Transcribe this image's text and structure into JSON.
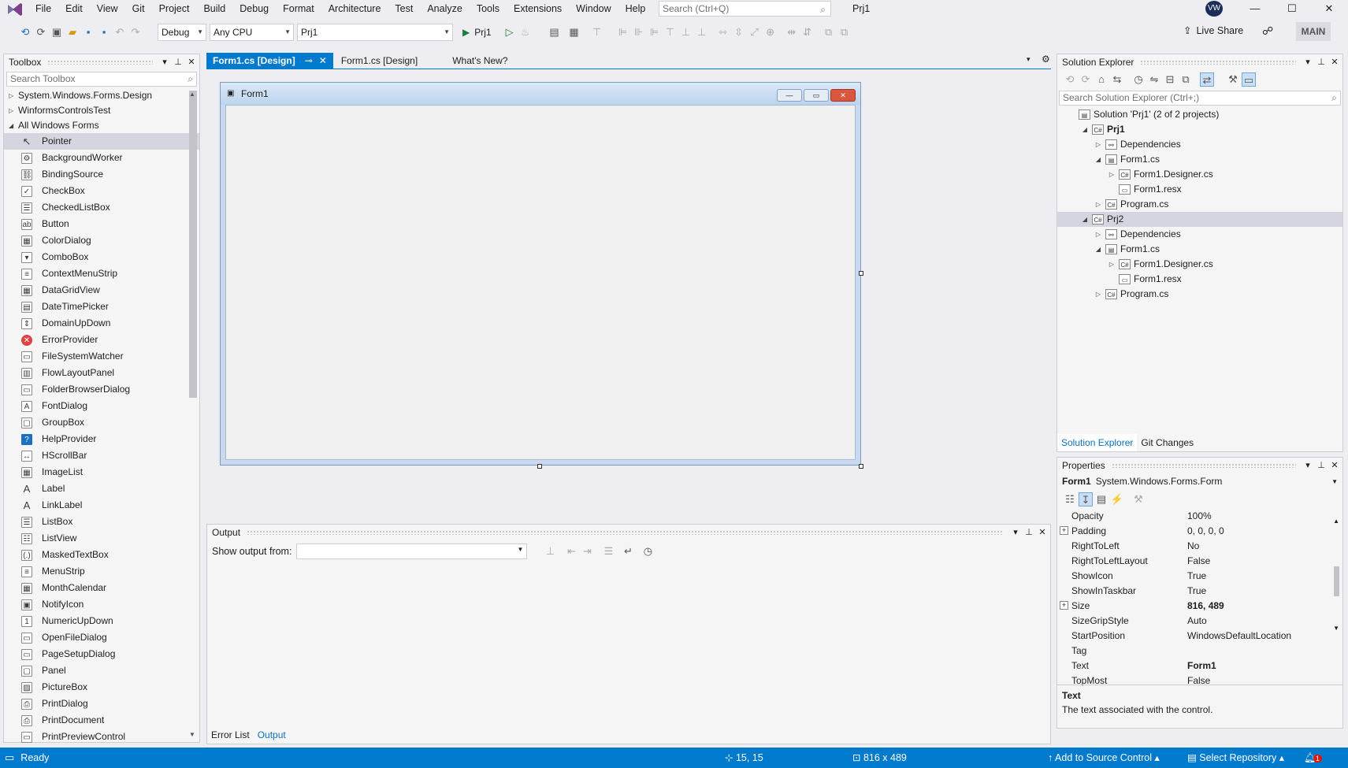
{
  "menu": {
    "items": [
      "File",
      "Edit",
      "View",
      "Git",
      "Project",
      "Build",
      "Debug",
      "Format",
      "Architecture",
      "Test",
      "Analyze",
      "Tools",
      "Extensions",
      "Window",
      "Help"
    ],
    "search_placeholder": "Search (Ctrl+Q)",
    "solution_title": "Prj1",
    "avatar_initials": "VW"
  },
  "toolbar": {
    "config": "Debug",
    "platform": "Any CPU",
    "startup_project": "Prj1",
    "run_label": "Prj1",
    "live_share": "Live Share",
    "main_badge": "MAIN"
  },
  "toolbox": {
    "title": "Toolbox",
    "search_placeholder": "Search Toolbox",
    "groups": [
      "System.Windows.Forms.Design",
      "WinformsControlsTest",
      "All Windows Forms"
    ],
    "items": [
      {
        "label": "Pointer",
        "icon": "pointer-icon",
        "glyph": "↖"
      },
      {
        "label": "BackgroundWorker",
        "icon": "background-worker-icon",
        "glyph": "⚙"
      },
      {
        "label": "BindingSource",
        "icon": "binding-source-icon",
        "glyph": "⛓"
      },
      {
        "label": "CheckBox",
        "icon": "checkbox-icon",
        "glyph": "✓"
      },
      {
        "label": "CheckedListBox",
        "icon": "checked-list-icon",
        "glyph": "☰"
      },
      {
        "label": "Button",
        "icon": "button-icon",
        "glyph": "ab"
      },
      {
        "label": "ColorDialog",
        "icon": "color-dialog-icon",
        "glyph": "▦"
      },
      {
        "label": "ComboBox",
        "icon": "combobox-icon",
        "glyph": "▾"
      },
      {
        "label": "ContextMenuStrip",
        "icon": "context-menu-icon",
        "glyph": "≡"
      },
      {
        "label": "DataGridView",
        "icon": "datagrid-icon",
        "glyph": "▦"
      },
      {
        "label": "DateTimePicker",
        "icon": "datetime-icon",
        "glyph": "▤"
      },
      {
        "label": "DomainUpDown",
        "icon": "domain-updown-icon",
        "glyph": "⇕"
      },
      {
        "label": "ErrorProvider",
        "icon": "error-provider-icon",
        "glyph": "✕"
      },
      {
        "label": "FileSystemWatcher",
        "icon": "file-watcher-icon",
        "glyph": "▭"
      },
      {
        "label": "FlowLayoutPanel",
        "icon": "flow-layout-icon",
        "glyph": "▥"
      },
      {
        "label": "FolderBrowserDialog",
        "icon": "folder-browser-icon",
        "glyph": "▭"
      },
      {
        "label": "FontDialog",
        "icon": "font-dialog-icon",
        "glyph": "A"
      },
      {
        "label": "GroupBox",
        "icon": "groupbox-icon",
        "glyph": "▢"
      },
      {
        "label": "HelpProvider",
        "icon": "help-provider-icon",
        "glyph": "?"
      },
      {
        "label": "HScrollBar",
        "icon": "hscrollbar-icon",
        "glyph": "↔"
      },
      {
        "label": "ImageList",
        "icon": "imagelist-icon",
        "glyph": "▦"
      },
      {
        "label": "Label",
        "icon": "label-icon",
        "glyph": "A"
      },
      {
        "label": "LinkLabel",
        "icon": "linklabel-icon",
        "glyph": "A"
      },
      {
        "label": "ListBox",
        "icon": "listbox-icon",
        "glyph": "☰"
      },
      {
        "label": "ListView",
        "icon": "listview-icon",
        "glyph": "☷"
      },
      {
        "label": "MaskedTextBox",
        "icon": "masked-textbox-icon",
        "glyph": "(.)"
      },
      {
        "label": "MenuStrip",
        "icon": "menustrip-icon",
        "glyph": "≡"
      },
      {
        "label": "MonthCalendar",
        "icon": "month-calendar-icon",
        "glyph": "▦"
      },
      {
        "label": "NotifyIcon",
        "icon": "notify-icon",
        "glyph": "▣"
      },
      {
        "label": "NumericUpDown",
        "icon": "numeric-updown-icon",
        "glyph": "1"
      },
      {
        "label": "OpenFileDialog",
        "icon": "open-file-dialog-icon",
        "glyph": "▭"
      },
      {
        "label": "PageSetupDialog",
        "icon": "page-setup-icon",
        "glyph": "▭"
      },
      {
        "label": "Panel",
        "icon": "panel-icon",
        "glyph": "▢"
      },
      {
        "label": "PictureBox",
        "icon": "picturebox-icon",
        "glyph": "▨"
      },
      {
        "label": "PrintDialog",
        "icon": "print-dialog-icon",
        "glyph": "⎙"
      },
      {
        "label": "PrintDocument",
        "icon": "print-document-icon",
        "glyph": "⎙"
      },
      {
        "label": "PrintPreviewControl",
        "icon": "print-preview-icon",
        "glyph": "▭"
      }
    ]
  },
  "tabs": [
    {
      "label": "Form1.cs [Design]",
      "active": true
    },
    {
      "label": "Form1.cs [Design]",
      "active": false
    },
    {
      "label": "What's New?",
      "active": false
    }
  ],
  "designer": {
    "form_title": "Form1"
  },
  "output": {
    "title": "Output",
    "show_from": "Show output from:",
    "bottom_tabs": [
      "Error List",
      "Output"
    ]
  },
  "solution_explorer": {
    "title": "Solution Explorer",
    "search_placeholder": "Search Solution Explorer (Ctrl+;)",
    "nodes": [
      {
        "label": "Solution 'Prj1' (2 of 2 projects)",
        "level": 0,
        "twist": "",
        "icon": "solution-icon",
        "glyph": "▤",
        "bold": false
      },
      {
        "label": "Prj1",
        "level": 1,
        "twist": "◢",
        "icon": "csproj-icon",
        "glyph": "C#",
        "bold": true
      },
      {
        "label": "Dependencies",
        "level": 2,
        "twist": "▷",
        "icon": "dependencies-icon",
        "glyph": "⚯",
        "bold": false
      },
      {
        "label": "Form1.cs",
        "level": 2,
        "twist": "◢",
        "icon": "form-file-icon",
        "glyph": "▤",
        "bold": false
      },
      {
        "label": "Form1.Designer.cs",
        "level": 3,
        "twist": "▷",
        "icon": "csharp-file-icon",
        "glyph": "C#",
        "bold": false
      },
      {
        "label": "Form1.resx",
        "level": 3,
        "twist": "",
        "icon": "resx-file-icon",
        "glyph": "▭",
        "bold": false
      },
      {
        "label": "Program.cs",
        "level": 2,
        "twist": "▷",
        "icon": "csharp-file-icon",
        "glyph": "C#",
        "bold": false
      },
      {
        "label": "Prj2",
        "level": 1,
        "twist": "◢",
        "icon": "csproj-icon",
        "glyph": "C#",
        "bold": false,
        "selected": true
      },
      {
        "label": "Dependencies",
        "level": 2,
        "twist": "▷",
        "icon": "dependencies-icon",
        "glyph": "⚯",
        "bold": false
      },
      {
        "label": "Form1.cs",
        "level": 2,
        "twist": "◢",
        "icon": "form-file-icon",
        "glyph": "▤",
        "bold": false
      },
      {
        "label": "Form1.Designer.cs",
        "level": 3,
        "twist": "▷",
        "icon": "csharp-file-icon",
        "glyph": "C#",
        "bold": false
      },
      {
        "label": "Form1.resx",
        "level": 3,
        "twist": "",
        "icon": "resx-file-icon",
        "glyph": "▭",
        "bold": false
      },
      {
        "label": "Program.cs",
        "level": 2,
        "twist": "▷",
        "icon": "csharp-file-icon",
        "glyph": "C#",
        "bold": false
      }
    ],
    "bottom_tabs": [
      "Solution Explorer",
      "Git Changes"
    ]
  },
  "properties": {
    "title": "Properties",
    "object_name": "Form1",
    "object_type": "System.Windows.Forms.Form",
    "rows": [
      {
        "name": "Opacity",
        "value": "100%",
        "expand": false,
        "bold": false
      },
      {
        "name": "Padding",
        "value": "0, 0, 0, 0",
        "expand": true,
        "bold": false
      },
      {
        "name": "RightToLeft",
        "value": "No",
        "expand": false,
        "bold": false
      },
      {
        "name": "RightToLeftLayout",
        "value": "False",
        "expand": false,
        "bold": false
      },
      {
        "name": "ShowIcon",
        "value": "True",
        "expand": false,
        "bold": false
      },
      {
        "name": "ShowInTaskbar",
        "value": "True",
        "expand": false,
        "bold": false
      },
      {
        "name": "Size",
        "value": "816, 489",
        "expand": true,
        "bold": true
      },
      {
        "name": "SizeGripStyle",
        "value": "Auto",
        "expand": false,
        "bold": false
      },
      {
        "name": "StartPosition",
        "value": "WindowsDefaultLocation",
        "expand": false,
        "bold": false
      },
      {
        "name": "Tag",
        "value": "",
        "expand": false,
        "bold": false
      },
      {
        "name": "Text",
        "value": "Form1",
        "expand": false,
        "bold": true
      },
      {
        "name": "TopMost",
        "value": "False",
        "expand": false,
        "bold": false
      }
    ],
    "desc_title": "Text",
    "desc_text": "The text associated with the control."
  },
  "status": {
    "ready": "Ready",
    "position": "15, 15",
    "size": "816 x 489",
    "add_source": "Add to Source Control",
    "select_repo": "Select Repository",
    "notifications": "1"
  },
  "colors": {
    "accent": "#007acc",
    "chrome": "#eeeef2"
  }
}
